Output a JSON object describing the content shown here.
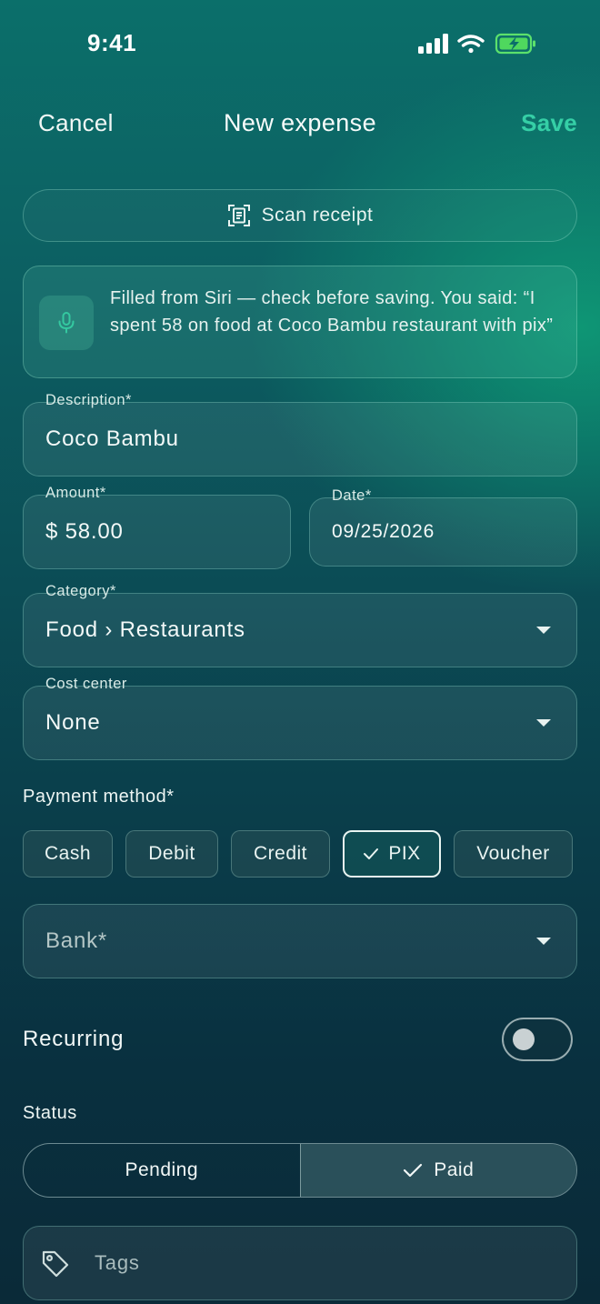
{
  "status_bar": {
    "time": "9:41"
  },
  "nav": {
    "cancel_label": "Cancel",
    "title": "New expense",
    "save_label": "Save"
  },
  "scan": {
    "label": "Scan receipt",
    "icon": "scan-receipt-icon"
  },
  "siri": {
    "icon": "microphone-icon",
    "message": "Filled from Siri — check before saving. You said: “I spent 58 on food at Coco Bambu restaurant with pix”"
  },
  "form": {
    "description": {
      "label": "Description*",
      "value": "Coco Bambu"
    },
    "amount": {
      "label": "Amount*",
      "value": "$ 58.00"
    },
    "date": {
      "label": "Date*",
      "value": "09/25/2026"
    },
    "category": {
      "label": "Category*",
      "value": "Food › Restaurants"
    },
    "cost_center": {
      "label": "Cost center",
      "value": "None"
    }
  },
  "payment": {
    "label": "Payment method*",
    "options": [
      "Cash",
      "Debit",
      "Credit",
      "PIX",
      "Voucher"
    ],
    "selected": "PIX",
    "bank_placeholder": "Bank*"
  },
  "recurring": {
    "label": "Recurring",
    "enabled": false
  },
  "status": {
    "label": "Status",
    "options": [
      "Pending",
      "Paid"
    ],
    "selected": "Paid"
  },
  "tags": {
    "placeholder": "Tags",
    "icon": "tag-icon"
  },
  "colors": {
    "accent": "#35cfa6",
    "background_top": "#0b6f6a",
    "background_bottom": "#0a2a38"
  }
}
